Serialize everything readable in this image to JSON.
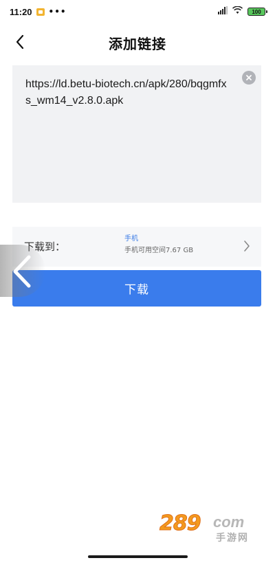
{
  "status_bar": {
    "time": "11:20",
    "dots": "•••",
    "battery_level": "100"
  },
  "header": {
    "title": "添加链接"
  },
  "url_input": {
    "value": "https://ld.betu-biotech.cn/apk/280/bqgmfxs_wm14_v2.8.0.apk"
  },
  "destination": {
    "label": "下载到：",
    "name": "手机",
    "free_space": "手机可用空间7.67 GB"
  },
  "download_button": {
    "label": "下载"
  },
  "watermark": {
    "number": "289",
    "domain": "com",
    "subtitle": "手游网"
  },
  "colors": {
    "accent": "#3a7cec",
    "dest_name": "#3a7be6",
    "box_bg": "#f1f2f4"
  }
}
